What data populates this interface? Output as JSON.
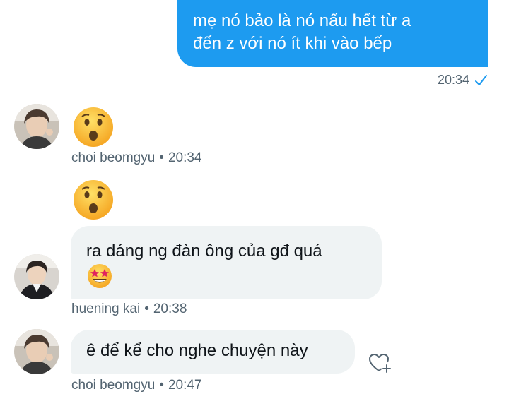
{
  "messages": [
    {
      "direction": "out",
      "text": "mẹ nó bảo là nó nấu hết từ a đến z với nó ít khi vào bếp",
      "time": "20:34",
      "status": "sent"
    },
    {
      "direction": "in",
      "sender": "choi beomgyu",
      "time": "20:34",
      "content": "astonished-emoji"
    },
    {
      "direction": "in",
      "sender": "huening kai",
      "time": "20:38",
      "content": [
        "astonished-emoji",
        "ra dáng ng đàn ông của gđ quá",
        "star-struck-emoji"
      ]
    },
    {
      "direction": "in",
      "sender": "choi beomgyu",
      "time": "20:47",
      "text": "ê để kể cho nghe chuyện này"
    }
  ],
  "out_msg": {
    "line1": "mẹ nó bảo là nó nấu hết từ a",
    "line2": "đến z với nó ít khi vào bếp",
    "time": "20:34"
  },
  "msg2": {
    "sender": "choi beomgyu",
    "sep": "•",
    "time": "20:34"
  },
  "msg3": {
    "text": "ra dáng ng đàn ông của gđ quá",
    "sender": "huening kai",
    "sep": "•",
    "time": "20:38"
  },
  "msg4": {
    "text": "ê để kể cho nghe chuyện này",
    "sender": "choi beomgyu",
    "sep": "•",
    "time": "20:47"
  },
  "icons": {
    "read_status": "checkmark-icon",
    "react": "heart-plus-icon",
    "emoji1": "astonished-face",
    "emoji2": "astonished-face",
    "emoji3": "star-struck-face"
  },
  "colors": {
    "accent": "#1d9bf0",
    "incoming_bg": "#eff3f4",
    "meta_text": "#536471",
    "text": "#0f1419"
  }
}
